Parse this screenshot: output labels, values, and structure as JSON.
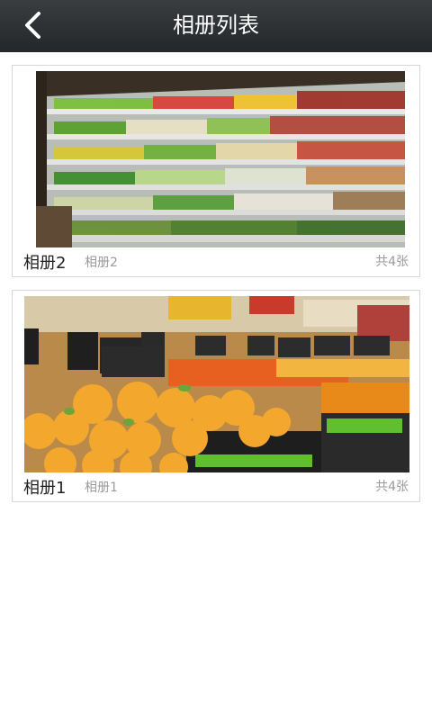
{
  "header": {
    "title": "相册列表",
    "back_icon": "chevron-left-icon"
  },
  "albums": [
    {
      "name": "相册2",
      "subtitle": "相册2",
      "count": "共4张",
      "photo": "supermarket refrigerated shelf"
    },
    {
      "name": "相册1",
      "subtitle": "相册1",
      "count": "共4张",
      "photo": "grapefruit fruit display"
    }
  ],
  "colors": {
    "header_bg": "#2b2f32",
    "header_text": "#ffffff",
    "card_border": "#d7d7d7",
    "secondary_text": "#9a9a9a"
  }
}
